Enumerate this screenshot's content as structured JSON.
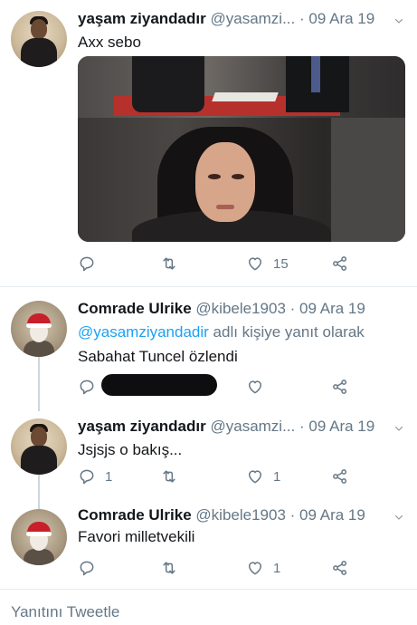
{
  "tweets": [
    {
      "name": "yaşam ziyandadır",
      "handle": "@yasamzi...",
      "date": "09 Ara 19",
      "text": "Axx sebo",
      "replies": "",
      "retweets": "",
      "likes": "15"
    },
    {
      "name": "Comrade Ulrike",
      "handle": "@kibele1903",
      "date": "09 Ara 19",
      "reply_mention": "@yasamziyandadir",
      "reply_suffix": " adlı kişiye yanıt olarak",
      "text": "Sabahat Tuncel özlendi",
      "replies": "",
      "likes": ""
    },
    {
      "name": "yaşam ziyandadır",
      "handle": "@yasamzi...",
      "date": "09 Ara 19",
      "text": "Jsjsjs o bakış...",
      "replies": "1",
      "retweets": "",
      "likes": "1"
    },
    {
      "name": "Comrade Ulrike",
      "handle": "@kibele1903",
      "date": "09 Ara 19",
      "text": "Favori milletvekili",
      "replies": "",
      "retweets": "",
      "likes": "1"
    }
  ],
  "separator": "·",
  "reply_bar": {
    "placeholder": "Yanıtını Tweetle"
  },
  "icons": {
    "reply": "reply-icon",
    "retweet": "retweet-icon",
    "like": "heart-icon",
    "share": "share-icon",
    "more": "chevron-down-icon"
  },
  "colors": {
    "text": "#14171a",
    "secondary": "#657786",
    "link": "#1da1f2",
    "divider": "#e6ecf0"
  }
}
